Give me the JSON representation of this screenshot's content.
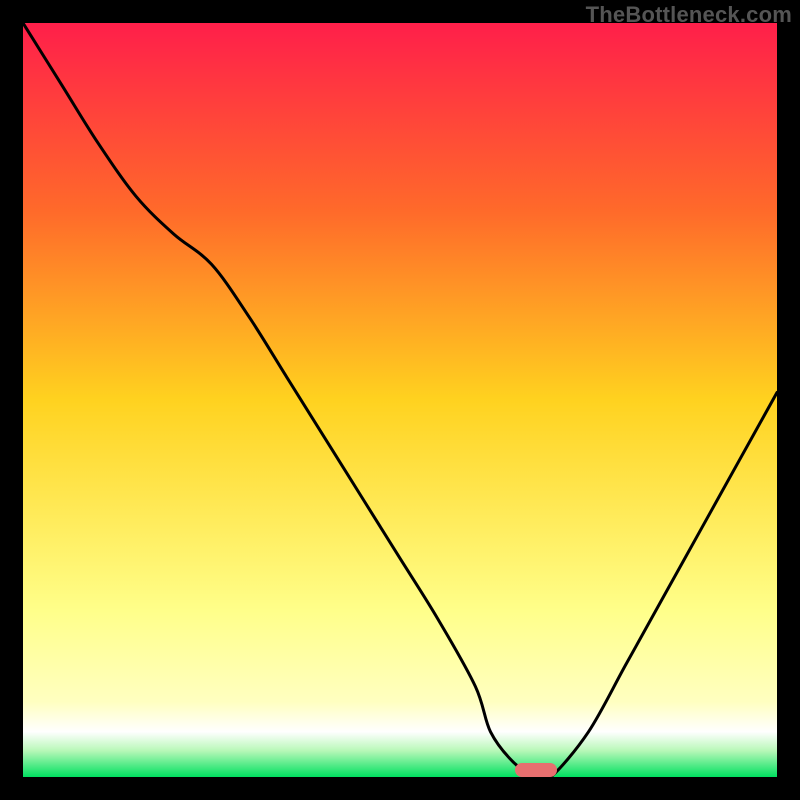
{
  "watermark": "TheBottleneck.com",
  "colors": {
    "top": "#ff1f4a",
    "upper_mid": "#ff8a2a",
    "mid": "#ffd21f",
    "lower_mid": "#ffff7a",
    "white_band": "#ffffff",
    "green": "#00e060",
    "curve": "#000000",
    "marker": "#e76f6f",
    "frame": "#000000"
  },
  "chart_data": {
    "type": "line",
    "title": "",
    "xlabel": "",
    "ylabel": "",
    "xlim": [
      0,
      100
    ],
    "ylim": [
      0,
      100
    ],
    "x": [
      0,
      5,
      10,
      15,
      20,
      25,
      30,
      35,
      40,
      45,
      50,
      55,
      60,
      62,
      65,
      68,
      70,
      75,
      80,
      85,
      90,
      95,
      100
    ],
    "y": [
      100,
      92,
      84,
      77,
      72,
      68,
      61,
      53,
      45,
      37,
      29,
      21,
      12,
      6,
      2,
      0,
      0,
      6,
      15,
      24,
      33,
      42,
      51
    ],
    "minimum_x": 68,
    "minimum_y": 0,
    "gradient_stops": [
      {
        "offset": 0.0,
        "color": "#ff1f4a"
      },
      {
        "offset": 0.25,
        "color": "#ff6a2a"
      },
      {
        "offset": 0.5,
        "color": "#ffd21f"
      },
      {
        "offset": 0.78,
        "color": "#ffff8a"
      },
      {
        "offset": 0.9,
        "color": "#ffffc0"
      },
      {
        "offset": 0.94,
        "color": "#ffffff"
      },
      {
        "offset": 0.965,
        "color": "#b8f8b8"
      },
      {
        "offset": 1.0,
        "color": "#00e060"
      }
    ]
  }
}
